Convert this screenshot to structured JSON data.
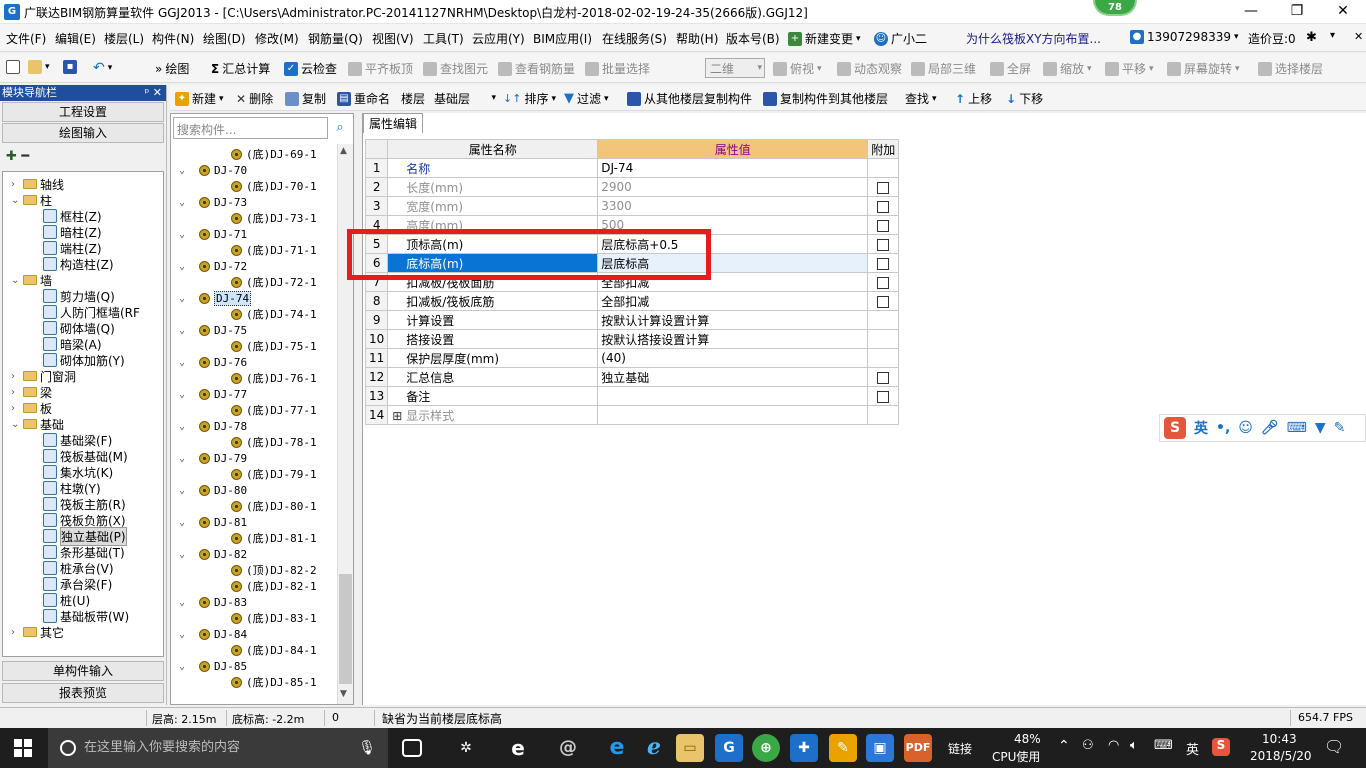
{
  "window": {
    "title": "广联达BIM钢筋算量软件 GGJ2013 - [C:\\Users\\Administrator.PC-20141127NRHM\\Desktop\\白龙村-2018-02-02-19-24-35(2666版).GGJ12]",
    "badge": "78",
    "min_glyph": "—",
    "max_glyph": "❐",
    "close_glyph": "✕"
  },
  "menu": {
    "items": [
      "文件(F)",
      "编辑(E)",
      "楼层(L)",
      "构件(N)",
      "绘图(D)",
      "修改(M)",
      "钢筋量(Q)",
      "视图(V)",
      "工具(T)",
      "云应用(Y)",
      "BIM应用(I)",
      "在线服务(S)",
      "帮助(H)",
      "版本号(B)"
    ],
    "new_change": "新建变更",
    "assistant": "广小二",
    "question": "为什么筏板XY方向布置...",
    "phone": "13907298339",
    "beans": "造价豆:0"
  },
  "toolbar1": {
    "draw": "绘图",
    "sum": "汇总计算",
    "cloud_check": "云检查",
    "flush_top": "平齐板顶",
    "find_element": "查找图元",
    "view_rebar": "查看钢筋量",
    "batch_select": "批量选择",
    "view_mode": "二维",
    "top_view": "俯视",
    "dynamic_view": "动态观察",
    "local_3d": "局部三维",
    "fullscreen": "全屏",
    "zoom": "缩放",
    "pan": "平移",
    "rotate": "屏幕旋转",
    "select_floor": "选择楼层"
  },
  "toolbar2": {
    "new": "新建",
    "delete": "删除",
    "copy": "复制",
    "rename": "重命名",
    "floor_label": "楼层",
    "floor_value": "基础层",
    "sort": "排序",
    "filter": "过滤",
    "copy_from": "从其他楼层复制构件",
    "copy_to": "复制构件到其他楼层",
    "find": "查找",
    "up": "上移",
    "down": "下移"
  },
  "leftpanel": {
    "header": "模块导航栏",
    "pin": "ᵖ ✕",
    "project_settings": "工程设置",
    "drawing_input": "绘图输入",
    "single_input": "单构件输入",
    "report_preview": "报表预览",
    "tree": [
      {
        "label": "轴线",
        "level": 0,
        "type": "folder",
        "exp": "›"
      },
      {
        "label": "柱",
        "level": 0,
        "type": "folder",
        "exp": "⌄"
      },
      {
        "label": "框柱(Z)",
        "level": 1,
        "type": "item"
      },
      {
        "label": "暗柱(Z)",
        "level": 1,
        "type": "item"
      },
      {
        "label": "端柱(Z)",
        "level": 1,
        "type": "item"
      },
      {
        "label": "构造柱(Z)",
        "level": 1,
        "type": "item"
      },
      {
        "label": "墙",
        "level": 0,
        "type": "folder",
        "exp": "⌄"
      },
      {
        "label": "剪力墙(Q)",
        "level": 1,
        "type": "item"
      },
      {
        "label": "人防门框墙(RF",
        "level": 1,
        "type": "item"
      },
      {
        "label": "砌体墙(Q)",
        "level": 1,
        "type": "item"
      },
      {
        "label": "暗梁(A)",
        "level": 1,
        "type": "item"
      },
      {
        "label": "砌体加筋(Y)",
        "level": 1,
        "type": "item"
      },
      {
        "label": "门窗洞",
        "level": 0,
        "type": "folder",
        "exp": "›"
      },
      {
        "label": "梁",
        "level": 0,
        "type": "folder",
        "exp": "›"
      },
      {
        "label": "板",
        "level": 0,
        "type": "folder",
        "exp": "›"
      },
      {
        "label": "基础",
        "level": 0,
        "type": "folder",
        "exp": "⌄"
      },
      {
        "label": "基础梁(F)",
        "level": 1,
        "type": "item"
      },
      {
        "label": "筏板基础(M)",
        "level": 1,
        "type": "item"
      },
      {
        "label": "集水坑(K)",
        "level": 1,
        "type": "item"
      },
      {
        "label": "柱墩(Y)",
        "level": 1,
        "type": "item"
      },
      {
        "label": "筏板主筋(R)",
        "level": 1,
        "type": "item"
      },
      {
        "label": "筏板负筋(X)",
        "level": 1,
        "type": "item"
      },
      {
        "label": "独立基础(P)",
        "level": 1,
        "type": "item",
        "selected": true
      },
      {
        "label": "条形基础(T)",
        "level": 1,
        "type": "item"
      },
      {
        "label": "桩承台(V)",
        "level": 1,
        "type": "item"
      },
      {
        "label": "承台梁(F)",
        "level": 1,
        "type": "item"
      },
      {
        "label": "桩(U)",
        "level": 1,
        "type": "item"
      },
      {
        "label": "基础板带(W)",
        "level": 1,
        "type": "item"
      },
      {
        "label": "其它",
        "level": 0,
        "type": "folder",
        "exp": "›"
      }
    ]
  },
  "components": {
    "search_placeholder": "搜索构件...",
    "tree": [
      {
        "label": "(底)DJ-69-1",
        "level": 1
      },
      {
        "label": "DJ-70",
        "level": 0
      },
      {
        "label": "(底)DJ-70-1",
        "level": 1
      },
      {
        "label": "DJ-73",
        "level": 0
      },
      {
        "label": "(底)DJ-73-1",
        "level": 1
      },
      {
        "label": "DJ-71",
        "level": 0
      },
      {
        "label": "(底)DJ-71-1",
        "level": 1
      },
      {
        "label": "DJ-72",
        "level": 0
      },
      {
        "label": "(底)DJ-72-1",
        "level": 1
      },
      {
        "label": "DJ-74",
        "level": 0,
        "selected": true
      },
      {
        "label": "(底)DJ-74-1",
        "level": 1
      },
      {
        "label": "DJ-75",
        "level": 0
      },
      {
        "label": "(底)DJ-75-1",
        "level": 1
      },
      {
        "label": "DJ-76",
        "level": 0
      },
      {
        "label": "(底)DJ-76-1",
        "level": 1
      },
      {
        "label": "DJ-77",
        "level": 0
      },
      {
        "label": "(底)DJ-77-1",
        "level": 1
      },
      {
        "label": "DJ-78",
        "level": 0
      },
      {
        "label": "(底)DJ-78-1",
        "level": 1
      },
      {
        "label": "DJ-79",
        "level": 0
      },
      {
        "label": "(底)DJ-79-1",
        "level": 1
      },
      {
        "label": "DJ-80",
        "level": 0
      },
      {
        "label": "(底)DJ-80-1",
        "level": 1
      },
      {
        "label": "DJ-81",
        "level": 0
      },
      {
        "label": "(底)DJ-81-1",
        "level": 1
      },
      {
        "label": "DJ-82",
        "level": 0
      },
      {
        "label": "(顶)DJ-82-2",
        "level": 1
      },
      {
        "label": "(底)DJ-82-1",
        "level": 1
      },
      {
        "label": "DJ-83",
        "level": 0
      },
      {
        "label": "(底)DJ-83-1",
        "level": 1
      },
      {
        "label": "DJ-84",
        "level": 0
      },
      {
        "label": "(底)DJ-84-1",
        "level": 1
      },
      {
        "label": "DJ-85",
        "level": 0
      },
      {
        "label": "(底)DJ-85-1",
        "level": 1
      }
    ]
  },
  "properties": {
    "tab": "属性编辑",
    "headers": {
      "name": "属性名称",
      "value": "属性值",
      "extra": "附加"
    },
    "rows": [
      {
        "num": "1",
        "name": "名称",
        "value": "DJ-74",
        "style": "blue",
        "cb": false
      },
      {
        "num": "2",
        "name": "长度(mm)",
        "value": "2900",
        "style": "gray",
        "cb": true
      },
      {
        "num": "3",
        "name": "宽度(mm)",
        "value": "3300",
        "style": "gray",
        "cb": true
      },
      {
        "num": "4",
        "name": "高度(mm)",
        "value": "500",
        "style": "gray",
        "cb": true
      },
      {
        "num": "5",
        "name": "顶标高(m)",
        "value": "层底标高+0.5",
        "style": "",
        "cb": true
      },
      {
        "num": "6",
        "name": "底标高(m)",
        "value": "层底标高",
        "style": "sel",
        "cb": true
      },
      {
        "num": "7",
        "name": "扣减板/筏板面筋",
        "value": "全部扣减",
        "style": "",
        "cb": true
      },
      {
        "num": "8",
        "name": "扣减板/筏板底筋",
        "value": "全部扣减",
        "style": "",
        "cb": true
      },
      {
        "num": "9",
        "name": "计算设置",
        "value": "按默认计算设置计算",
        "style": "",
        "cb": false
      },
      {
        "num": "10",
        "name": "搭接设置",
        "value": "按默认搭接设置计算",
        "style": "",
        "cb": false
      },
      {
        "num": "11",
        "name": "保护层厚度(mm)",
        "value": "(40)",
        "style": "",
        "cb": false
      },
      {
        "num": "12",
        "name": "汇总信息",
        "value": "独立基础",
        "style": "",
        "cb": true
      },
      {
        "num": "13",
        "name": "备注",
        "value": "",
        "style": "",
        "cb": true
      },
      {
        "num": "14",
        "name": "显示样式",
        "value": "",
        "style": "gray",
        "cb": false,
        "plus": true
      }
    ]
  },
  "ime": {
    "logo": "S",
    "lang": "英"
  },
  "status": {
    "floor_height": "层高: 2.15m",
    "bottom_elev": "底标高: -2.2m",
    "zero": "0",
    "hint": "缺省为当前楼层底标高",
    "fps": "654.7 FPS"
  },
  "taskbar": {
    "search": "在这里输入你要搜索的内容",
    "link": "链接",
    "cpu_pct": "48%",
    "cpu_label": "CPU使用",
    "ime": "英",
    "time": "10:43",
    "date": "2018/5/20"
  }
}
